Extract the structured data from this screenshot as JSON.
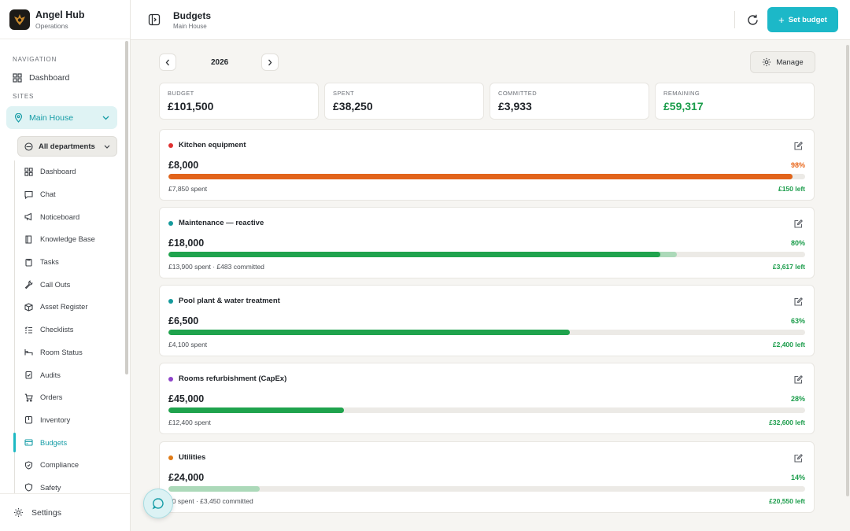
{
  "app": {
    "name": "Angel Hub",
    "subtitle": "Operations"
  },
  "sidebar": {
    "nav_section": "NAVIGATION",
    "dashboard": "Dashboard",
    "sites_section": "SITES",
    "site": "Main House",
    "department": "All departments",
    "items": [
      {
        "label": "Dashboard",
        "icon": "grid-icon"
      },
      {
        "label": "Chat",
        "icon": "chat-icon"
      },
      {
        "label": "Noticeboard",
        "icon": "megaphone-icon"
      },
      {
        "label": "Knowledge Base",
        "icon": "book-icon"
      },
      {
        "label": "Tasks",
        "icon": "clipboard-icon"
      },
      {
        "label": "Call Outs",
        "icon": "wrench-icon"
      },
      {
        "label": "Asset Register",
        "icon": "box-icon"
      },
      {
        "label": "Checklists",
        "icon": "list-check-icon"
      },
      {
        "label": "Room Status",
        "icon": "bed-icon"
      },
      {
        "label": "Audits",
        "icon": "clipboard-check-icon"
      },
      {
        "label": "Orders",
        "icon": "cart-icon"
      },
      {
        "label": "Inventory",
        "icon": "package-icon"
      },
      {
        "label": "Budgets",
        "icon": "wallet-icon",
        "active": true
      },
      {
        "label": "Compliance",
        "icon": "shield-icon"
      },
      {
        "label": "Safety",
        "icon": "shield-check-icon"
      }
    ],
    "settings": "Settings"
  },
  "header": {
    "title": "Budgets",
    "subtitle": "Main House",
    "set_budget": "Set budget"
  },
  "toolbar": {
    "year": "2026",
    "manage": "Manage"
  },
  "stats": [
    {
      "label": "BUDGET",
      "value": "£101,500"
    },
    {
      "label": "SPENT",
      "value": "£38,250"
    },
    {
      "label": "COMMITTED",
      "value": "£3,933"
    },
    {
      "label": "REMAINING",
      "value": "£59,317",
      "color": "#1a9c4a"
    }
  ],
  "colors": {
    "accent": "#1cb8c8",
    "green": "#1a9c4a",
    "orange": "#e8661a"
  },
  "budgets": [
    {
      "name": "Kitchen equipment",
      "dot": "#e03131",
      "amount": "£8,000",
      "percent": "98%",
      "spent_fraction": 0.98,
      "committed_fraction": 0,
      "bar_color": "#e2641b",
      "pct_color": "#e8661a",
      "spent_text": "£7,850 spent",
      "left_text": "£150 left"
    },
    {
      "name": "Maintenance — reactive",
      "dot": "#159a9c",
      "amount": "£18,000",
      "percent": "80%",
      "spent_fraction": 0.772,
      "committed_fraction": 0.027,
      "bar_color": "#1fa34d",
      "pct_color": "#1a9c4a",
      "spent_text": "£13,900 spent · £483 committed",
      "left_text": "£3,617 left"
    },
    {
      "name": "Pool plant & water treatment",
      "dot": "#159a9c",
      "amount": "£6,500",
      "percent": "63%",
      "spent_fraction": 0.63,
      "committed_fraction": 0,
      "bar_color": "#1fa34d",
      "pct_color": "#1a9c4a",
      "spent_text": "£4,100 spent",
      "left_text": "£2,400 left"
    },
    {
      "name": "Rooms refurbishment (CapEx)",
      "dot": "#8e44c9",
      "amount": "£45,000",
      "percent": "28%",
      "spent_fraction": 0.276,
      "committed_fraction": 0,
      "bar_color": "#1fa34d",
      "pct_color": "#1a9c4a",
      "spent_text": "£12,400 spent",
      "left_text": "£32,600 left"
    },
    {
      "name": "Utilities",
      "dot": "#e07b17",
      "amount": "£24,000",
      "percent": "14%",
      "spent_fraction": 0,
      "committed_fraction": 0.144,
      "bar_color": "#1fa34d",
      "pct_color": "#1a9c4a",
      "spent_text": "£0 spent · £3,450 committed",
      "left_text": "£20,550 left"
    }
  ]
}
